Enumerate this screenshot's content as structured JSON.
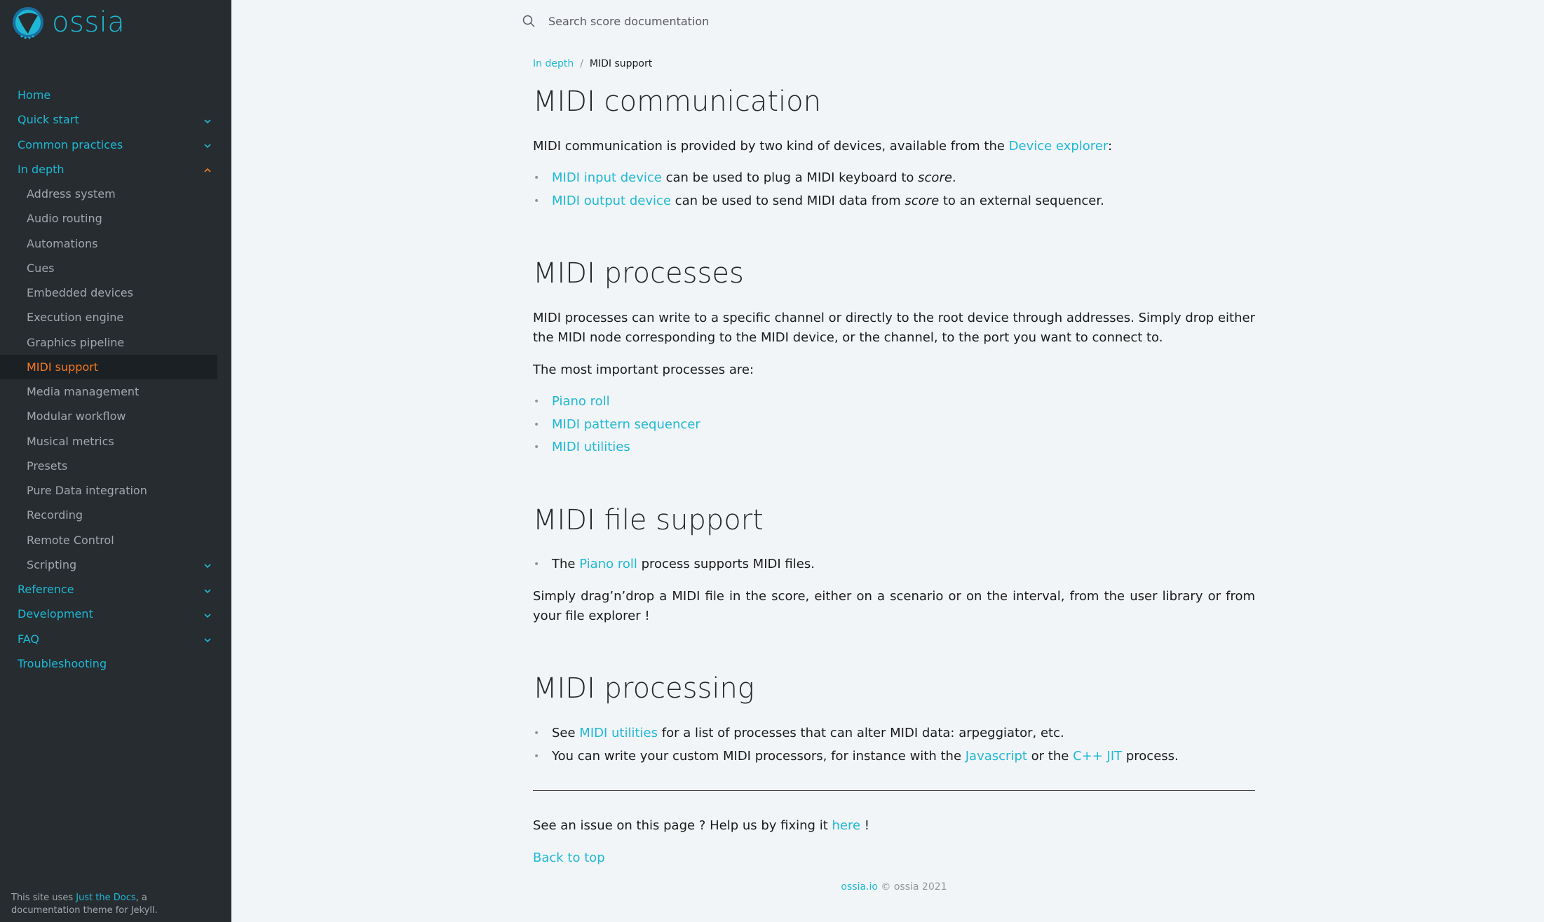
{
  "brand": {
    "name": "ossia"
  },
  "sidebar": {
    "items": [
      {
        "label": "Home",
        "has_children": false
      },
      {
        "label": "Quick start",
        "has_children": true
      },
      {
        "label": "Common practices",
        "has_children": true
      },
      {
        "label": "In depth",
        "has_children": true,
        "expanded": true
      }
    ],
    "in_depth_children": [
      {
        "label": "Address system"
      },
      {
        "label": "Audio routing"
      },
      {
        "label": "Automations"
      },
      {
        "label": "Cues"
      },
      {
        "label": "Embedded devices"
      },
      {
        "label": "Execution engine"
      },
      {
        "label": "Graphics pipeline"
      },
      {
        "label": "MIDI support",
        "active": true
      },
      {
        "label": "Media management"
      },
      {
        "label": "Modular workflow"
      },
      {
        "label": "Musical metrics"
      },
      {
        "label": "Presets"
      },
      {
        "label": "Pure Data integration"
      },
      {
        "label": "Recording"
      },
      {
        "label": "Remote Control"
      },
      {
        "label": "Scripting",
        "has_children": true
      }
    ],
    "after_items": [
      {
        "label": "Reference",
        "has_children": true
      },
      {
        "label": "Development",
        "has_children": true
      },
      {
        "label": "FAQ",
        "has_children": true
      },
      {
        "label": "Troubleshooting",
        "has_children": false
      }
    ],
    "footer": {
      "prefix": "This site uses ",
      "link": "Just the Docs",
      "suffix": ", a documentation theme for Jekyll."
    }
  },
  "search": {
    "placeholder": "Search score documentation"
  },
  "breadcrumb": {
    "parent": "In depth",
    "separator": "/",
    "current": "MIDI support"
  },
  "sections": {
    "communication": {
      "title": "MIDI communication",
      "intro_prefix": "MIDI communication is provided by two kind of devices, available from the ",
      "intro_link": "Device explorer",
      "intro_suffix": ":",
      "items": [
        {
          "link": "MIDI input device",
          "text_before_em": " can be used to plug a MIDI keyboard to ",
          "em": "score",
          "text_after_em": "."
        },
        {
          "link": "MIDI output device",
          "text_before_em": " can be used to send MIDI data from ",
          "em": "score",
          "text_after_em": " to an external sequencer."
        }
      ]
    },
    "processes": {
      "title": "MIDI processes",
      "paragraph": "MIDI processes can write to a specific channel or directly to the root device through addresses. Simply drop either the MIDI node corresponding to the MIDI device, or the channel, to the port you want to connect to.",
      "important": "The most important processes are:",
      "links": [
        "Piano roll",
        "MIDI pattern sequencer",
        "MIDI utilities"
      ]
    },
    "file_support": {
      "title": "MIDI file support",
      "item_prefix": "The ",
      "item_link": "Piano roll",
      "item_suffix": " process supports MIDI files.",
      "paragraph": "Simply drag’n’drop a MIDI file in the score, either on a scenario or on the interval, from the user library or from your file explorer !"
    },
    "processing": {
      "title": "MIDI processing",
      "item1_prefix": "See ",
      "item1_link": "MIDI utilities",
      "item1_suffix": " for a list of processes that can alter MIDI data: arpeggiator, etc.",
      "item2_prefix": "You can write your custom MIDI processors, for instance with the ",
      "item2_link1": "Javascript",
      "item2_mid": " or the ",
      "item2_link2": "C++ JIT",
      "item2_suffix": " process."
    }
  },
  "issue": {
    "prefix": "See an issue on this page ? Help us by fixing it ",
    "link": "here",
    "suffix": " !"
  },
  "back_to_top": "Back to top",
  "footer": {
    "link": "ossia.io",
    "text": " © ossia 2021"
  },
  "colors": {
    "link": "#1fb8d4",
    "active": "#f57a1f",
    "sidebar_bg": "#262c30",
    "page_bg": "#f2f5f8"
  }
}
